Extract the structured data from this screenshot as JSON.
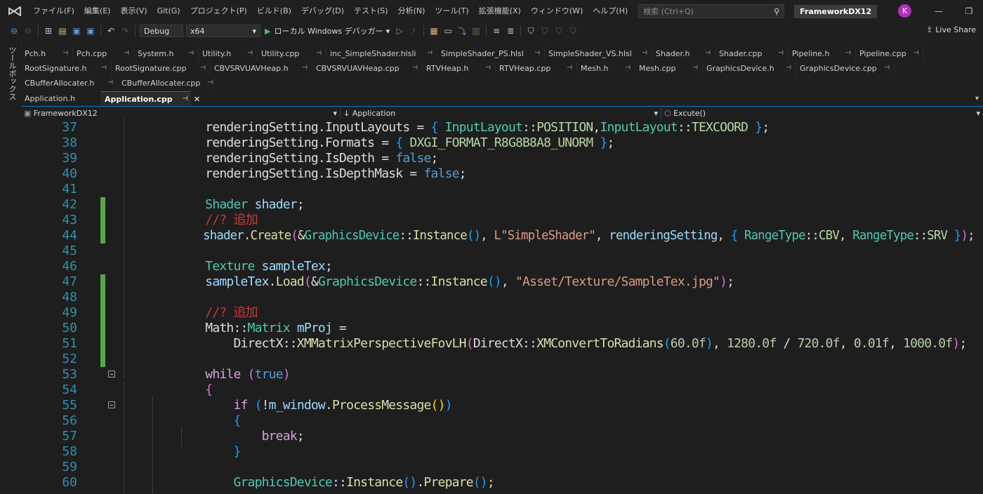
{
  "menubar": {
    "items": [
      "ファイル(F)",
      "編集(E)",
      "表示(V)",
      "Git(G)",
      "プロジェクト(P)",
      "ビルド(B)",
      "デバッグ(D)",
      "テスト(S)",
      "分析(N)",
      "ツール(T)",
      "拡張機能(X)",
      "ウィンドウ(W)",
      "ヘルプ(H)"
    ],
    "search_placeholder": "検索 (Ctrl+Q)",
    "solution_title": "FrameworkDX12",
    "avatar_initial": "K"
  },
  "toolbar": {
    "config": "Debug",
    "platform": "x64",
    "run_label": "ローカル Windows デバッガー",
    "live_share": "Live Share"
  },
  "toolbox_label": "ツールボックス",
  "tabs_row1": [
    "Pch.h",
    "Pch.cpp",
    "System.h",
    "Utility.h",
    "Utility.cpp",
    "inc_SimpleShader.hlsli",
    "SimpleShader_PS.hlsl",
    "SimpleShader_VS.hlsl",
    "Shader.h",
    "Shader.cpp",
    "Pipeline.h",
    "Pipeline.cpp"
  ],
  "tabs_row2": [
    "RootSignature.h",
    "RootSignature.cpp",
    "CBVSRVUAVHeap.h",
    "CBVSRVUAVHeap.cpp",
    "RTVHeap.h",
    "RTVHeap.cpp",
    "Mesh.h",
    "Mesh.cpp",
    "GraphicsDevice.h",
    "GraphicsDevice.cpp"
  ],
  "tabs_row3": [
    "CBufferAllocater.h",
    "CBufferAllocater.cpp"
  ],
  "tabs_row4": {
    "inactive": "Application.h",
    "active": "Application.cpp"
  },
  "navbar": {
    "project": "FrameworkDX12",
    "scope": "Application",
    "member": "Excute()"
  },
  "editor": {
    "lines": [
      {
        "n": "37",
        "changed": false,
        "fold": false
      },
      {
        "n": "38",
        "changed": false,
        "fold": false
      },
      {
        "n": "39",
        "changed": false,
        "fold": false
      },
      {
        "n": "40",
        "changed": false,
        "fold": false
      },
      {
        "n": "41",
        "changed": false,
        "fold": false
      },
      {
        "n": "42",
        "changed": true,
        "fold": false
      },
      {
        "n": "43",
        "changed": true,
        "fold": false
      },
      {
        "n": "44",
        "changed": true,
        "fold": false
      },
      {
        "n": "45",
        "changed": false,
        "fold": false
      },
      {
        "n": "46",
        "changed": false,
        "fold": false
      },
      {
        "n": "47",
        "changed": true,
        "fold": false
      },
      {
        "n": "48",
        "changed": true,
        "fold": false
      },
      {
        "n": "49",
        "changed": true,
        "fold": false
      },
      {
        "n": "50",
        "changed": true,
        "fold": false
      },
      {
        "n": "51",
        "changed": true,
        "fold": false
      },
      {
        "n": "52",
        "changed": true,
        "fold": false
      },
      {
        "n": "53",
        "changed": false,
        "fold": true
      },
      {
        "n": "54",
        "changed": false,
        "fold": false
      },
      {
        "n": "55",
        "changed": false,
        "fold": true
      },
      {
        "n": "56",
        "changed": false,
        "fold": false
      },
      {
        "n": "57",
        "changed": false,
        "fold": false
      },
      {
        "n": "58",
        "changed": false,
        "fold": false
      },
      {
        "n": "59",
        "changed": false,
        "fold": false
      },
      {
        "n": "60",
        "changed": false,
        "fold": false
      }
    ],
    "code": [
      [
        [
          "        ",
          "k-id"
        ],
        [
          "renderingSetting",
          "k-id"
        ],
        [
          ".",
          "k-id"
        ],
        [
          "InputLayouts",
          "k-id"
        ],
        [
          " = ",
          "k-id"
        ],
        [
          "{",
          "k-br3"
        ],
        [
          " ",
          "k-id"
        ],
        [
          "InputLayout",
          "k-type"
        ],
        [
          "::",
          "k-id"
        ],
        [
          "POSITION",
          "k-enum"
        ],
        [
          ",",
          "k-id"
        ],
        [
          "InputLayout",
          "k-type"
        ],
        [
          "::",
          "k-id"
        ],
        [
          "TEXCOORD",
          "k-enum"
        ],
        [
          " ",
          "k-id"
        ],
        [
          "}",
          "k-br3"
        ],
        [
          ";",
          "k-id"
        ]
      ],
      [
        [
          "        ",
          "k-id"
        ],
        [
          "renderingSetting",
          "k-id"
        ],
        [
          ".",
          "k-id"
        ],
        [
          "Formats",
          "k-id"
        ],
        [
          " = ",
          "k-id"
        ],
        [
          "{",
          "k-br3"
        ],
        [
          " ",
          "k-id"
        ],
        [
          "DXGI_FORMAT_R8G8B8A8_UNORM",
          "k-enum"
        ],
        [
          " ",
          "k-id"
        ],
        [
          "}",
          "k-br3"
        ],
        [
          ";",
          "k-id"
        ]
      ],
      [
        [
          "        ",
          "k-id"
        ],
        [
          "renderingSetting",
          "k-id"
        ],
        [
          ".",
          "k-id"
        ],
        [
          "IsDepth",
          "k-id"
        ],
        [
          " = ",
          "k-id"
        ],
        [
          "false",
          "k-kw"
        ],
        [
          ";",
          "k-id"
        ]
      ],
      [
        [
          "        ",
          "k-id"
        ],
        [
          "renderingSetting",
          "k-id"
        ],
        [
          ".",
          "k-id"
        ],
        [
          "IsDepthMask",
          "k-id"
        ],
        [
          " = ",
          "k-id"
        ],
        [
          "false",
          "k-kw"
        ],
        [
          ";",
          "k-id"
        ]
      ],
      [
        [
          "",
          "k-id"
        ]
      ],
      [
        [
          "        ",
          "k-id"
        ],
        [
          "Shader",
          "k-type"
        ],
        [
          " ",
          "k-id"
        ],
        [
          "shader",
          "k-var"
        ],
        [
          ";",
          "k-id"
        ]
      ],
      [
        [
          "        ",
          "k-id"
        ],
        [
          "//? ",
          "k-cmtj"
        ],
        [
          "追加",
          "k-cmtj"
        ]
      ],
      [
        [
          "        ",
          "k-id"
        ],
        [
          "shader",
          "k-var"
        ],
        [
          ".",
          "k-id"
        ],
        [
          "Create",
          "k-fn"
        ],
        [
          "(",
          "k-br2"
        ],
        [
          "&",
          "k-id"
        ],
        [
          "GraphicsDevice",
          "k-type"
        ],
        [
          "::",
          "k-id"
        ],
        [
          "Instance",
          "k-fn"
        ],
        [
          "()",
          "k-br3"
        ],
        [
          ", ",
          "k-id"
        ],
        [
          "L\"SimpleShader\"",
          "k-str"
        ],
        [
          ", ",
          "k-id"
        ],
        [
          "renderingSetting",
          "k-var"
        ],
        [
          ", ",
          "k-id"
        ],
        [
          "{",
          "k-br3"
        ],
        [
          " ",
          "k-id"
        ],
        [
          "RangeType",
          "k-type"
        ],
        [
          "::",
          "k-id"
        ],
        [
          "CBV",
          "k-enum"
        ],
        [
          ", ",
          "k-id"
        ],
        [
          "RangeType",
          "k-type"
        ],
        [
          "::",
          "k-id"
        ],
        [
          "SRV",
          "k-enum"
        ],
        [
          " ",
          "k-id"
        ],
        [
          "}",
          "k-br3"
        ],
        [
          ")",
          "k-br2"
        ],
        [
          ";",
          "k-id"
        ]
      ],
      [
        [
          "",
          "k-id"
        ]
      ],
      [
        [
          "        ",
          "k-id"
        ],
        [
          "Texture",
          "k-type"
        ],
        [
          " ",
          "k-id"
        ],
        [
          "sampleTex",
          "k-var"
        ],
        [
          ";",
          "k-id"
        ]
      ],
      [
        [
          "        ",
          "k-id"
        ],
        [
          "sampleTex",
          "k-var"
        ],
        [
          ".",
          "k-id"
        ],
        [
          "Load",
          "k-fn"
        ],
        [
          "(",
          "k-br2"
        ],
        [
          "&",
          "k-id"
        ],
        [
          "GraphicsDevice",
          "k-type"
        ],
        [
          "::",
          "k-id"
        ],
        [
          "Instance",
          "k-fn"
        ],
        [
          "()",
          "k-br3"
        ],
        [
          ", ",
          "k-id"
        ],
        [
          "\"Asset/Texture/SampleTex.jpg\"",
          "k-str"
        ],
        [
          ")",
          "k-br2"
        ],
        [
          ";",
          "k-id"
        ]
      ],
      [
        [
          "",
          "k-id"
        ]
      ],
      [
        [
          "        ",
          "k-id"
        ],
        [
          "//? ",
          "k-cmtj"
        ],
        [
          "追加",
          "k-cmtj"
        ]
      ],
      [
        [
          "        ",
          "k-id"
        ],
        [
          "Math",
          "k-id"
        ],
        [
          "::",
          "k-id"
        ],
        [
          "Matrix",
          "k-type"
        ],
        [
          " ",
          "k-id"
        ],
        [
          "mProj",
          "k-var"
        ],
        [
          " =",
          "k-id"
        ]
      ],
      [
        [
          "            ",
          "k-id"
        ],
        [
          "DirectX",
          "k-id"
        ],
        [
          "::",
          "k-id"
        ],
        [
          "XMMatrixPerspectiveFovLH",
          "k-fn"
        ],
        [
          "(",
          "k-br2"
        ],
        [
          "DirectX",
          "k-id"
        ],
        [
          "::",
          "k-id"
        ],
        [
          "XMConvertToRadians",
          "k-fn"
        ],
        [
          "(",
          "k-br3"
        ],
        [
          "60.0f",
          "k-num"
        ],
        [
          ")",
          "k-br3"
        ],
        [
          ", ",
          "k-id"
        ],
        [
          "1280.0f",
          "k-num"
        ],
        [
          " / ",
          "k-id"
        ],
        [
          "720.0f",
          "k-num"
        ],
        [
          ", ",
          "k-id"
        ],
        [
          "0.01f",
          "k-num"
        ],
        [
          ", ",
          "k-id"
        ],
        [
          "1000.0f",
          "k-num"
        ],
        [
          ")",
          "k-br2"
        ],
        [
          ";",
          "k-id"
        ]
      ],
      [
        [
          "",
          "k-id"
        ]
      ],
      [
        [
          "        ",
          "k-id"
        ],
        [
          "while",
          "k-ctrl"
        ],
        [
          " ",
          "k-id"
        ],
        [
          "(",
          "k-br2"
        ],
        [
          "true",
          "k-kw"
        ],
        [
          ")",
          "k-br2"
        ]
      ],
      [
        [
          "        ",
          "k-id"
        ],
        [
          "{",
          "k-br2"
        ]
      ],
      [
        [
          "            ",
          "k-id"
        ],
        [
          "if",
          "k-ctrl"
        ],
        [
          " ",
          "k-id"
        ],
        [
          "(",
          "k-br3"
        ],
        [
          "!",
          "k-id"
        ],
        [
          "m_window",
          "k-var"
        ],
        [
          ".",
          "k-id"
        ],
        [
          "ProcessMessage",
          "k-fn"
        ],
        [
          "()",
          "k-br1"
        ],
        [
          ")",
          "k-br3"
        ]
      ],
      [
        [
          "            ",
          "k-id"
        ],
        [
          "{",
          "k-br3"
        ]
      ],
      [
        [
          "                ",
          "k-id"
        ],
        [
          "break",
          "k-ctrl"
        ],
        [
          ";",
          "k-id"
        ]
      ],
      [
        [
          "            ",
          "k-id"
        ],
        [
          "}",
          "k-br3"
        ]
      ],
      [
        [
          "",
          "k-id"
        ]
      ],
      [
        [
          "            ",
          "k-id"
        ],
        [
          "GraphicsDevice",
          "k-type"
        ],
        [
          "::",
          "k-id"
        ],
        [
          "Instance",
          "k-fn"
        ],
        [
          "()",
          "k-br3"
        ],
        [
          ".",
          "k-id"
        ],
        [
          "Prepare",
          "k-fn"
        ],
        [
          "()",
          "k-br3"
        ],
        [
          ";",
          "k-id"
        ]
      ]
    ]
  }
}
